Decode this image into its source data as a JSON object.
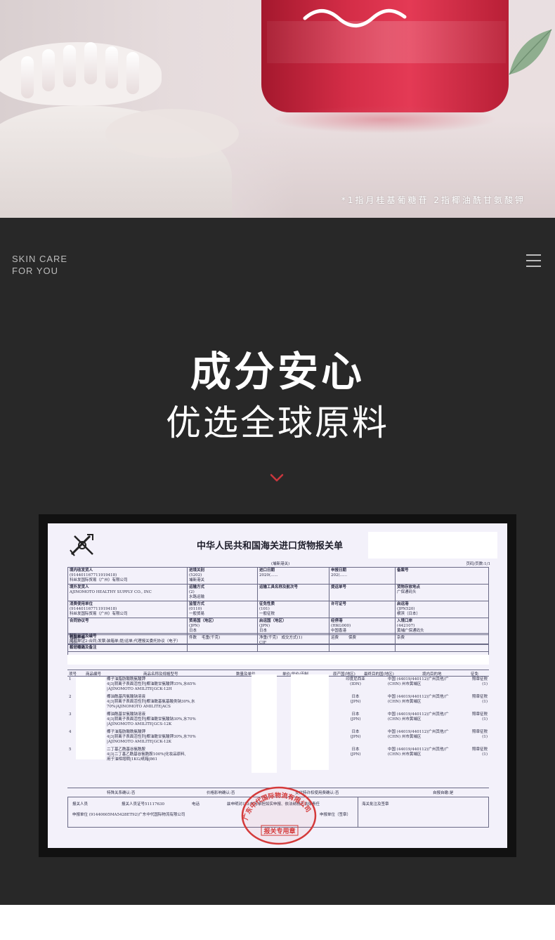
{
  "hero": {
    "footnote": "*1指月桂基葡糖苷  2指椰油酰甘氨酸钾"
  },
  "brand": {
    "line1": "SKIN CARE",
    "line2": "FOR YOU"
  },
  "headline": "成分安心",
  "subheadline": "优选全球原料",
  "declaration": {
    "title": "中华人民共和国海关进口货物报关单",
    "port_note": "(埔新港关)",
    "page": "页码/页数:1/1",
    "fields": {
      "consignee_label": "境内收发货人",
      "consignee_code": "(914401167711919418)",
      "consignee_name": "科丝发国际贸易（广州）有限公司",
      "entry_port_label": "进境关别",
      "entry_port_value": "(5202)",
      "entry_port_name": "埔新港关",
      "import_date_label": "进口日期",
      "import_date_value": "2020(......",
      "declare_date_label": "申报日期",
      "declare_date_value": "202(......",
      "record_label": "备案号",
      "overseas_shipper_label": "境外发货人",
      "overseas_shipper_value": "AJINOMOTO HEALTHY SUPPLY CO., INC",
      "transport_label": "运输方式",
      "transport_value": "(2)",
      "transport_name": "水路运输",
      "vessel_label": "运输工具名称及航次号",
      "bl_label": "提运单号",
      "goods_location_label": "货物存放地点",
      "goods_location_value": "广保通码头",
      "consumer_label": "消费使用单位",
      "consumer_code": "(914401167711919418)",
      "consumer_name": "科丝发国际贸易（广州）有限公司",
      "supervision_label": "监管方式",
      "supervision_value": "(0110)",
      "supervision_name": "一般贸易",
      "tax_label": "征免性质",
      "tax_value": "(101)",
      "tax_name": "一般征税",
      "license_label": "许可证号",
      "depart_port_label": "启运港",
      "depart_port_value": "(JPN520)",
      "depart_port_name": "横滨（日本）",
      "contract_label": "合同协议号",
      "trade_country_label": "贸易国（地区）",
      "trade_country_value": "(JPN)",
      "trade_country_name": "日本",
      "origin_country_label": "启运国（地区）",
      "origin_country_value": "(JPN)",
      "origin_country_name": "日本",
      "transit_port_label": "经停港",
      "transit_port_value": "(HKG000)",
      "transit_port_name": "中国香港",
      "entry_place_label": "入境口岸",
      "entry_place_value": "(442107)",
      "entry_place_name": "黄埔广保通码头",
      "package_label": "包装种类",
      "package_value": "(99)",
      "package_name": "其他包装",
      "pieces_label": "件数",
      "gross_label": "毛重(千克)",
      "net_label": "净重(千克)",
      "terms_label": "成交方式",
      "terms_value": "(1)",
      "terms_name": "CIF",
      "freight_label": "运费",
      "insurance_label": "保费",
      "misc_label": "杂费"
    },
    "docs_label": "随附单证及编号",
    "docs_value": "随附单证2:合同;发票;装箱单;提/运单;代理报关委托协议（电子）",
    "marks_label": "标记唛码及备注",
    "goods_header": {
      "no": "项号",
      "code": "商品编号",
      "desc": "商品名称及规格型号",
      "qty": "数量及单位",
      "price": "单价/总价/币制",
      "origin": "原产国(地区)",
      "final": "最终目的国(地区)",
      "domestic": "境内目的地",
      "exempt": "征免"
    },
    "items": [
      {
        "no": "1",
        "desc1": "椰子油脂肪酸酰氨酸钾",
        "desc2": "4|3|阴离子表面活性剂|椰油酰甘氨酸钾35%,水65%",
        "desc3": "|AJINOMOTO AMILITE|GCK-12H",
        "origin": "印度尼西亚",
        "origin_code": "(IDN)",
        "dest": "中国 (44019/440112)广州其他/广",
        "dest2": "(CHN)            州市黄埔区",
        "exempt": "照章征税",
        "exempt2": "(1)"
      },
      {
        "no": "2",
        "desc1": "椰油酰基丙氨酸钠溶液",
        "desc2": "4|3|阴离子表面活性剂|椰油酰基氨基酸类钠30%,水",
        "desc3": "70%|AJINOMOTO AMILITE|ACS",
        "origin": "日本",
        "origin_code": "(JPN)",
        "dest": "中国 (44019/440112)广州其他/广",
        "dest2": "(CHN)            州市黄埔区",
        "exempt": "照章征税",
        "exempt2": "(1)"
      },
      {
        "no": "3",
        "desc1": "椰油酰基甘氨酸钠溶液",
        "desc2": "4|3|阴离子表面活性剂|椰油酰甘氨酸钠30%,水70%",
        "desc3": "|AJINOMOTO AMILITE|GCS-12K",
        "origin": "日本",
        "origin_code": "(JPN)",
        "dest": "中国 (44019/440112)广州其他/广",
        "dest2": "(CHN)            州市黄埔区",
        "exempt": "照章征税",
        "exempt2": "(1)"
      },
      {
        "no": "4",
        "desc1": "椰子油脂肪酸酰氨酸钾",
        "desc2": "4|3|阴离子表面活性剂|椰油酰甘氨酸钾30%,水70%",
        "desc3": "|AJINOMOTO AMILITE|GCK-12K",
        "origin": "日本",
        "origin_code": "(JPN)",
        "dest": "中国 (44019/440112)广州其他/广",
        "dest2": "(CHN)            州市黄埔区",
        "exempt": "照章征税",
        "exempt2": "(1)"
      },
      {
        "no": "5",
        "desc1": "二丁基乙酰基谷氨酰胺",
        "desc2": "4|3|二丁基乙酰基谷氨酰胺100%|化妆品原料,",
        "desc3": "用于油相增稠|1KG/纸箱|861",
        "origin": "日本",
        "origin_code": "(JPN)",
        "dest": "中国 (44019/440112)广州其他/广",
        "dest2": "(CHN)            州市黄埔区",
        "exempt": "照章征税",
        "exempt2": "(1)"
      }
    ],
    "confirm": {
      "special": "特殊关系确认:否",
      "price_effect": "价格影响确认:否",
      "royalty": "支付特许权使用费确认:否",
      "self_report": "自报自缴:是"
    },
    "bottom": {
      "declarer": "报关人员",
      "declarer_cert": "报关人员证号51117630",
      "phone": "电话",
      "statement": "兹申明对以上内容承担如实申报、依法纳税之法律责任",
      "customs_note": "海关批注及签章",
      "agent": "申报单位 (91440605MA5428ET92)广东中代国际物流有限公司",
      "agent_stamp": "申报单位（签章）"
    },
    "stamp_top": "广东中代国际物流有限公司",
    "stamp_bottom": "报关专用章"
  }
}
